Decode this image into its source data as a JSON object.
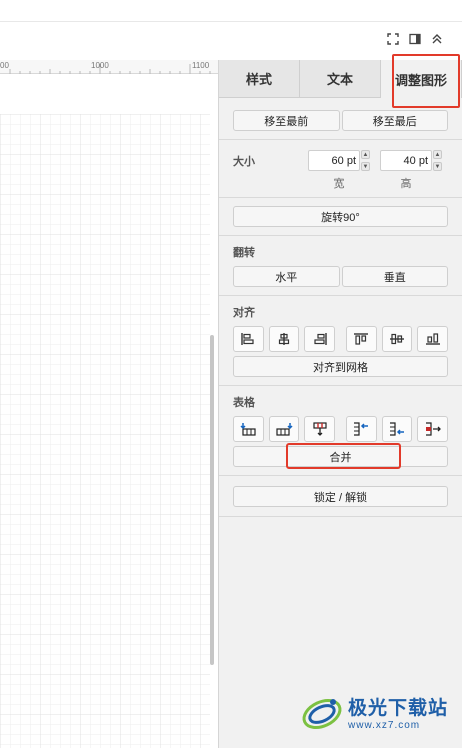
{
  "toolbar": {
    "icons": [
      "fullscreen-icon",
      "sidebar-toggle-icon",
      "collapse-up-icon"
    ]
  },
  "ruler": {
    "labels": [
      "00",
      "1000",
      "1100"
    ]
  },
  "panel": {
    "tabs": [
      {
        "label": "样式"
      },
      {
        "label": "文本"
      },
      {
        "label": "调整图形"
      }
    ],
    "arrange": {
      "to_front": "移至最前",
      "to_back": "移至最后"
    },
    "size": {
      "label": "大小",
      "width_value": "60 pt",
      "height_value": "40 pt",
      "width_caption": "宽",
      "height_caption": "高"
    },
    "rotate_label": "旋转90°",
    "flip": {
      "title": "翻转",
      "horizontal": "水平",
      "vertical": "垂直"
    },
    "align": {
      "title": "对齐",
      "snap_grid": "对齐到网格"
    },
    "table": {
      "title": "表格",
      "merge": "合并"
    },
    "lock_label": "锁定 / 解锁"
  },
  "watermark": {
    "title": "极光下载站",
    "url": "www.xz7.com"
  },
  "colors": {
    "highlight": "#e23a2a",
    "panel_bg": "#f1f1f1",
    "watermark": "#1f5fa8"
  }
}
